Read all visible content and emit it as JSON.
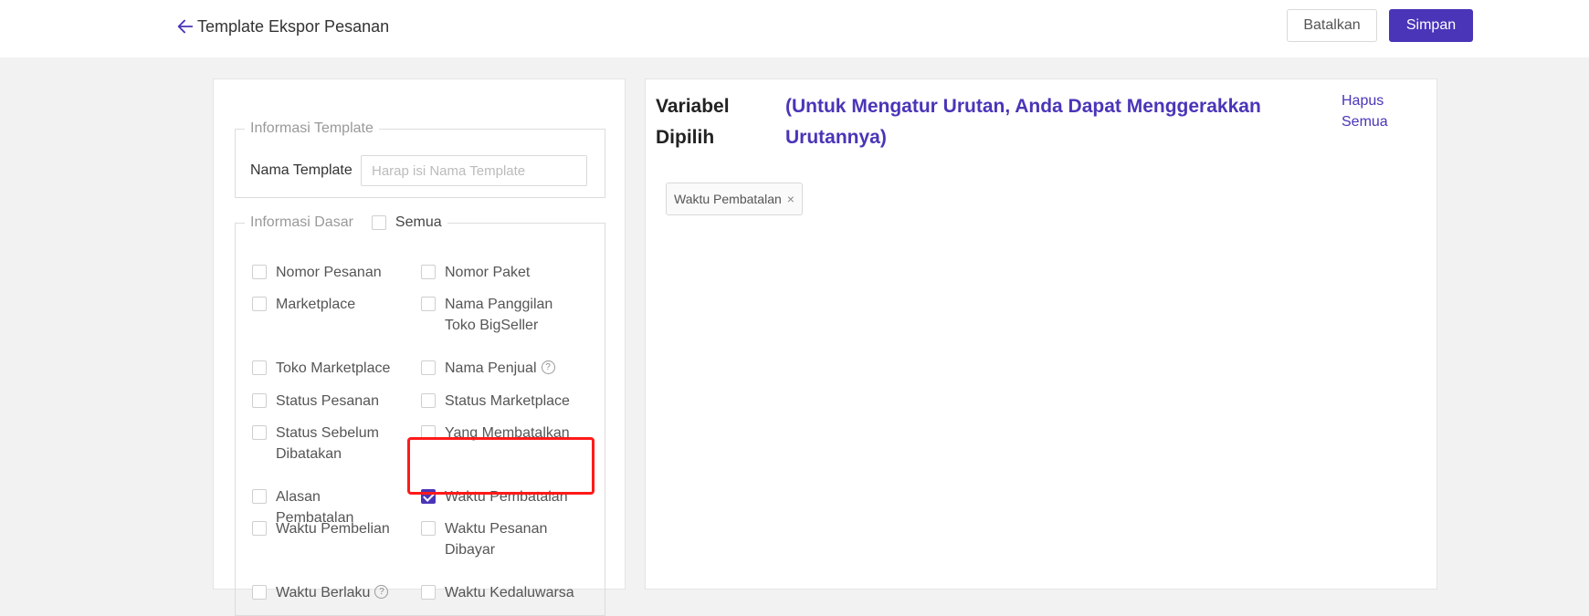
{
  "header": {
    "title": "Template Ekspor Pesanan",
    "cancel_label": "Batalkan",
    "save_label": "Simpan"
  },
  "template_info": {
    "legend": "Informasi Template",
    "name_label": "Nama Template",
    "name_value": "",
    "name_placeholder": "Harap isi Nama Template"
  },
  "basic_info": {
    "legend": "Informasi Dasar",
    "select_all_label": "Semua",
    "options": [
      {
        "label": "Nomor Pesanan",
        "checked": false,
        "help": false
      },
      {
        "label": "Nomor Paket",
        "checked": false,
        "help": false
      },
      {
        "label": "Marketplace",
        "checked": false,
        "help": false
      },
      {
        "label": "Nama Panggilan Toko BigSeller",
        "checked": false,
        "help": false
      },
      {
        "label": "Toko Marketplace",
        "checked": false,
        "help": false
      },
      {
        "label": "Nama Penjual",
        "checked": false,
        "help": true
      },
      {
        "label": "Status Pesanan",
        "checked": false,
        "help": false
      },
      {
        "label": "Status Marketplace",
        "checked": false,
        "help": false
      },
      {
        "label": "Status Sebelum Dibatakan",
        "checked": false,
        "help": false
      },
      {
        "label": "Yang Membatalkan",
        "checked": false,
        "help": false
      },
      {
        "label": "Alasan Pembatalan",
        "checked": false,
        "help": false
      },
      {
        "label": "Waktu Pembatalan",
        "checked": true,
        "help": false
      },
      {
        "label": "Waktu Pembelian",
        "checked": false,
        "help": false
      },
      {
        "label": "Waktu Pesanan Dibayar",
        "checked": false,
        "help": false
      },
      {
        "label": "Waktu Berlaku",
        "checked": false,
        "help": true
      },
      {
        "label": "Waktu Kedaluwarsa",
        "checked": false,
        "help": false
      }
    ]
  },
  "selected": {
    "title": "Variabel Dipilih",
    "hint": "(Untuk Mengatur Urutan, Anda Dapat Menggerakkan Urutannya)",
    "clear_label": "Hapus Semua",
    "tags": [
      "Waktu Pembatalan"
    ],
    "tag_close": "×"
  },
  "colors": {
    "accent": "#4a35b8",
    "highlight": "#ff1a1a"
  },
  "icons": {
    "back": "arrow-left-icon",
    "help": "question-circle-icon",
    "close": "close-icon"
  }
}
